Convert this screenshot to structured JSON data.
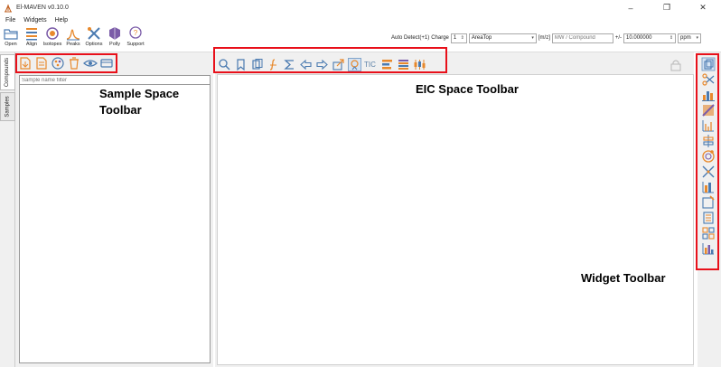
{
  "window": {
    "title": "El-MAVEN v0.10.0",
    "minimize_glyph": "–",
    "maximize_glyph": "❐",
    "close_glyph": "✕"
  },
  "menu": [
    "File",
    "Widgets",
    "Help"
  ],
  "main_toolbar": [
    {
      "label": "Open",
      "icon": "folder-icon"
    },
    {
      "label": "Align",
      "icon": "align-icon"
    },
    {
      "label": "Isotopes",
      "icon": "isotopes-icon"
    },
    {
      "label": "Peaks",
      "icon": "peaks-icon"
    },
    {
      "label": "Options",
      "icon": "options-icon"
    },
    {
      "label": "Polly",
      "icon": "polly-icon"
    },
    {
      "label": "Support",
      "icon": "support-icon"
    }
  ],
  "peak_controls": {
    "auto_detect": "Auto Detect(+1)",
    "charge_label": "Charge",
    "charge_value": "1",
    "quant_type": "AreaTop",
    "mz_label": "[m/z]",
    "compound_placeholder": "MW / Compound",
    "tolerance_label": "+/-",
    "tolerance_value": "10.000000",
    "unit": "ppm"
  },
  "left_tabs": [
    "Compounds",
    "Samples"
  ],
  "sample_filter_placeholder": "Sample name filter",
  "eic_toolbar": {
    "tic_label": "TIC"
  },
  "annotations": {
    "sample_space_line1": "Sample Space",
    "sample_space_line2": "Toolbar",
    "eic_space": "EIC Space Toolbar",
    "widget": "Widget Toolbar"
  },
  "colors": {
    "highlight": "#e8101a",
    "icon_orange": "#e8892c",
    "icon_blue": "#4a7ab0",
    "icon_purple": "#7b5ca8"
  }
}
